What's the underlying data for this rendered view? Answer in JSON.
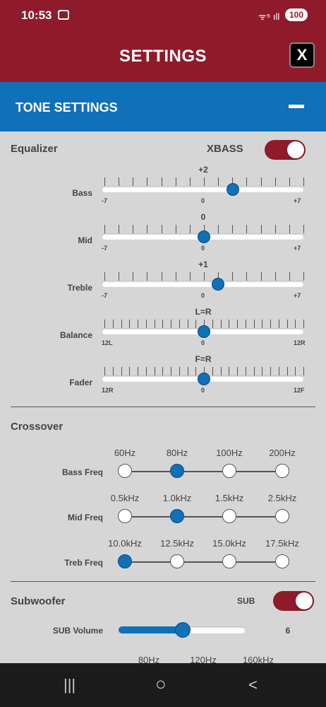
{
  "status": {
    "time": "10:53",
    "signal": "ᯤ⁵ ıll",
    "battery": "100"
  },
  "header": {
    "title": "SETTINGS",
    "close_label": "X"
  },
  "tone": {
    "title": "TONE SETTINGS",
    "collapse_symbol": "—"
  },
  "equalizer": {
    "title": "Equalizer",
    "xbass_label": "XBASS",
    "xbass_on": true,
    "sliders": [
      {
        "label": "Bass",
        "value": "+2",
        "min_label": "-7",
        "mid_label": "0",
        "max_label": "+7",
        "level": 0.643
      },
      {
        "label": "Mid",
        "value": "0",
        "min_label": "-7",
        "mid_label": "0",
        "max_label": "+7",
        "level": 0.5
      },
      {
        "label": "Treble",
        "value": "+1",
        "min_label": "-7",
        "mid_label": "0",
        "max_label": "+7",
        "level": 0.571
      },
      {
        "label": "Balance",
        "value": "L=R",
        "min_label": "12L",
        "mid_label": "0",
        "max_label": "12R",
        "level": 0.5
      },
      {
        "label": "Fader",
        "value": "F=R",
        "min_label": "12R",
        "mid_label": "0",
        "max_label": "12F",
        "level": 0.5
      }
    ]
  },
  "crossover": {
    "title": "Crossover",
    "rows": [
      {
        "label": "Bass Freq",
        "options": [
          "60Hz",
          "80Hz",
          "100Hz",
          "200Hz"
        ],
        "selected": 1
      },
      {
        "label": "Mid Freq",
        "options": [
          "0.5kHz",
          "1.0kHz",
          "1.5kHz",
          "2.5kHz"
        ],
        "selected": 1
      },
      {
        "label": "Treb Freq",
        "options": [
          "10.0kHz",
          "12.5kHz",
          "15.0kHz",
          "17.5kHz"
        ],
        "selected": 0
      }
    ]
  },
  "subwoofer": {
    "title": "Subwoofer",
    "sub_label": "SUB",
    "sub_on": true,
    "volume_label": "SUB Volume",
    "volume_value": "6",
    "volume_level": 0.5,
    "partial_options": [
      "80Hz",
      "120Hz",
      "160kHz"
    ]
  },
  "nav": {
    "recents": "|||",
    "home": "○",
    "back": "<"
  }
}
